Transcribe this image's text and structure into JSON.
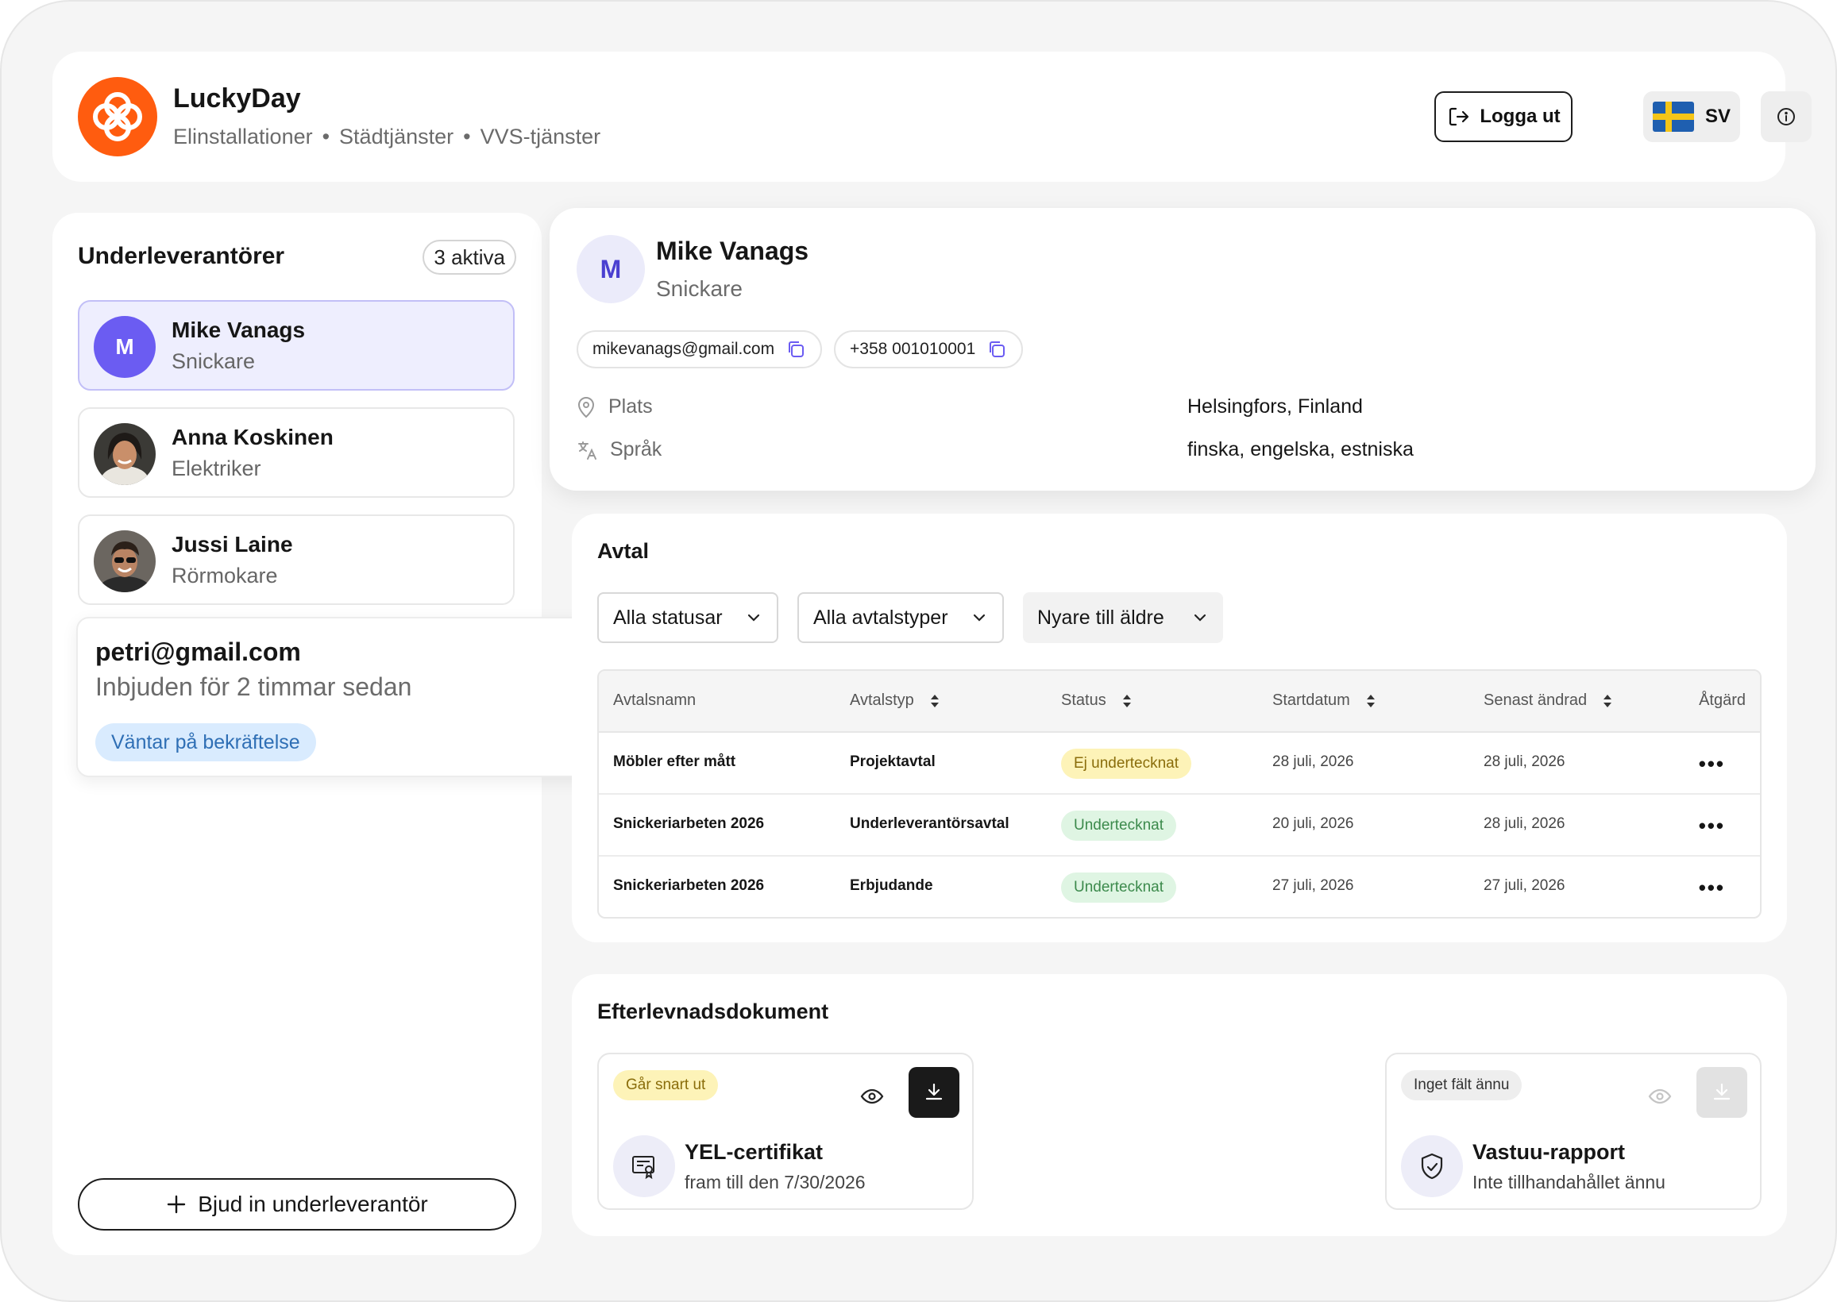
{
  "header": {
    "brand": "LuckyDay",
    "services": [
      "Elinstallationer",
      "Städtjänster",
      "VVS-tjänster"
    ],
    "separator": "•",
    "logout_label": "Logga ut",
    "language_label": "SV"
  },
  "sidebar": {
    "title": "Underleverantörer",
    "active_count": "3 aktiva",
    "people": [
      {
        "name": "Mike Vanags",
        "role": "Snickare",
        "initial": "M"
      },
      {
        "name": "Anna Koskinen",
        "role": "Elektriker"
      },
      {
        "name": "Jussi Laine",
        "role": "Rörmokare"
      }
    ],
    "invite": {
      "email": "petri@gmail.com",
      "time": "Inbjuden för 2 timmar sedan",
      "status": "Väntar på bekräftelse"
    },
    "invite_button": "Bjud in underleverantör"
  },
  "profile": {
    "initial": "M",
    "name": "Mike Vanags",
    "role": "Snickare",
    "email": "mikevanags@gmail.com",
    "phone": "+358 001010001",
    "location_label": "Plats",
    "location_value": "Helsingfors, Finland",
    "language_label": "Språk",
    "language_value": "finska, engelska, estniska"
  },
  "agreements": {
    "title": "Avtal",
    "filters": {
      "status": "Alla statusar",
      "type": "Alla avtalstyper",
      "sort": "Nyare till äldre"
    },
    "columns": [
      "Avtalsnamn",
      "Avtalstyp",
      "Status",
      "Startdatum",
      "Senast ändrad",
      "Åtgärd"
    ],
    "rows": [
      {
        "name": "Möbler efter mått",
        "type": "Projektavtal",
        "status": "Ej undertecknat",
        "start": "28 juli, 2026",
        "modified": "28 juli, 2026",
        "action": "•••"
      },
      {
        "name": "Snickeriarbeten 2026",
        "type": "Underleverantörsavtal",
        "status": "Undertecknat",
        "start": "20 juli, 2026",
        "modified": "28 juli, 2026",
        "action": "•••"
      },
      {
        "name": "Snickeriarbeten 2026",
        "type": "Erbjudande",
        "status": "Undertecknat",
        "start": "27 juli, 2026",
        "modified": "27 juli, 2026",
        "action": "•••"
      }
    ]
  },
  "compliance": {
    "title": "Efterlevnadsdokument",
    "docs": [
      {
        "badge": "Går snart ut",
        "name": "YEL-certifikat",
        "subtitle": "fram till den 7/30/2026"
      },
      {
        "badge": "Inget fält ännu",
        "name": "Vastuu-rapport",
        "subtitle": "Inte tillhandahållet ännu"
      }
    ]
  },
  "colors": {
    "brand": "#ff5c0f",
    "accent": "#6b5cf2",
    "warning_bg": "#fdf3b8",
    "success_bg": "#dff5e3",
    "info_bg": "#d9ebfe"
  },
  "icons": {
    "logo": "clover-logo-icon",
    "logout": "logout-icon",
    "flag": "swedish-flag-icon",
    "info": "info-icon",
    "copy": "copy-icon",
    "location": "map-pin-icon",
    "language": "translate-icon",
    "chevron": "chevron-down-icon",
    "sort": "sort-icon",
    "eye": "eye-icon",
    "download": "download-icon",
    "certificate": "certificate-icon",
    "shield": "shield-icon",
    "plus": "plus-icon"
  }
}
